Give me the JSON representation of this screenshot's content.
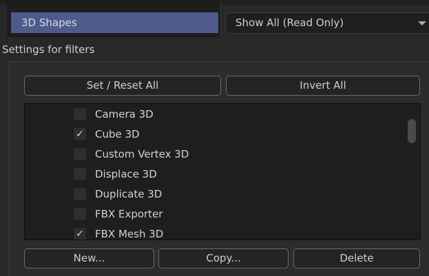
{
  "category": {
    "selected_label": "3D Shapes"
  },
  "view_mode": {
    "selected": "Show All (Read Only)",
    "arrow_icon": "chevron-down-icon"
  },
  "settings": {
    "label": "Settings for filters"
  },
  "toolbar": {
    "set_reset_label": "Set / Reset All",
    "invert_label": "Invert All"
  },
  "filters": [
    {
      "label": "Camera 3D",
      "checked": false,
      "check_mark": ""
    },
    {
      "label": "Cube 3D",
      "checked": true,
      "check_mark": "✓"
    },
    {
      "label": "Custom Vertex 3D",
      "checked": false,
      "check_mark": ""
    },
    {
      "label": "Displace 3D",
      "checked": false,
      "check_mark": ""
    },
    {
      "label": "Duplicate 3D",
      "checked": false,
      "check_mark": ""
    },
    {
      "label": "FBX Exporter",
      "checked": false,
      "check_mark": ""
    },
    {
      "label": "FBX Mesh 3D",
      "checked": true,
      "check_mark": "✓"
    }
  ],
  "actions": {
    "new_label": "New...",
    "copy_label": "Copy...",
    "delete_label": "Delete"
  },
  "colors": {
    "selection": "#4e5b8c",
    "background": "#282828",
    "list_background": "#1e1e1e"
  }
}
